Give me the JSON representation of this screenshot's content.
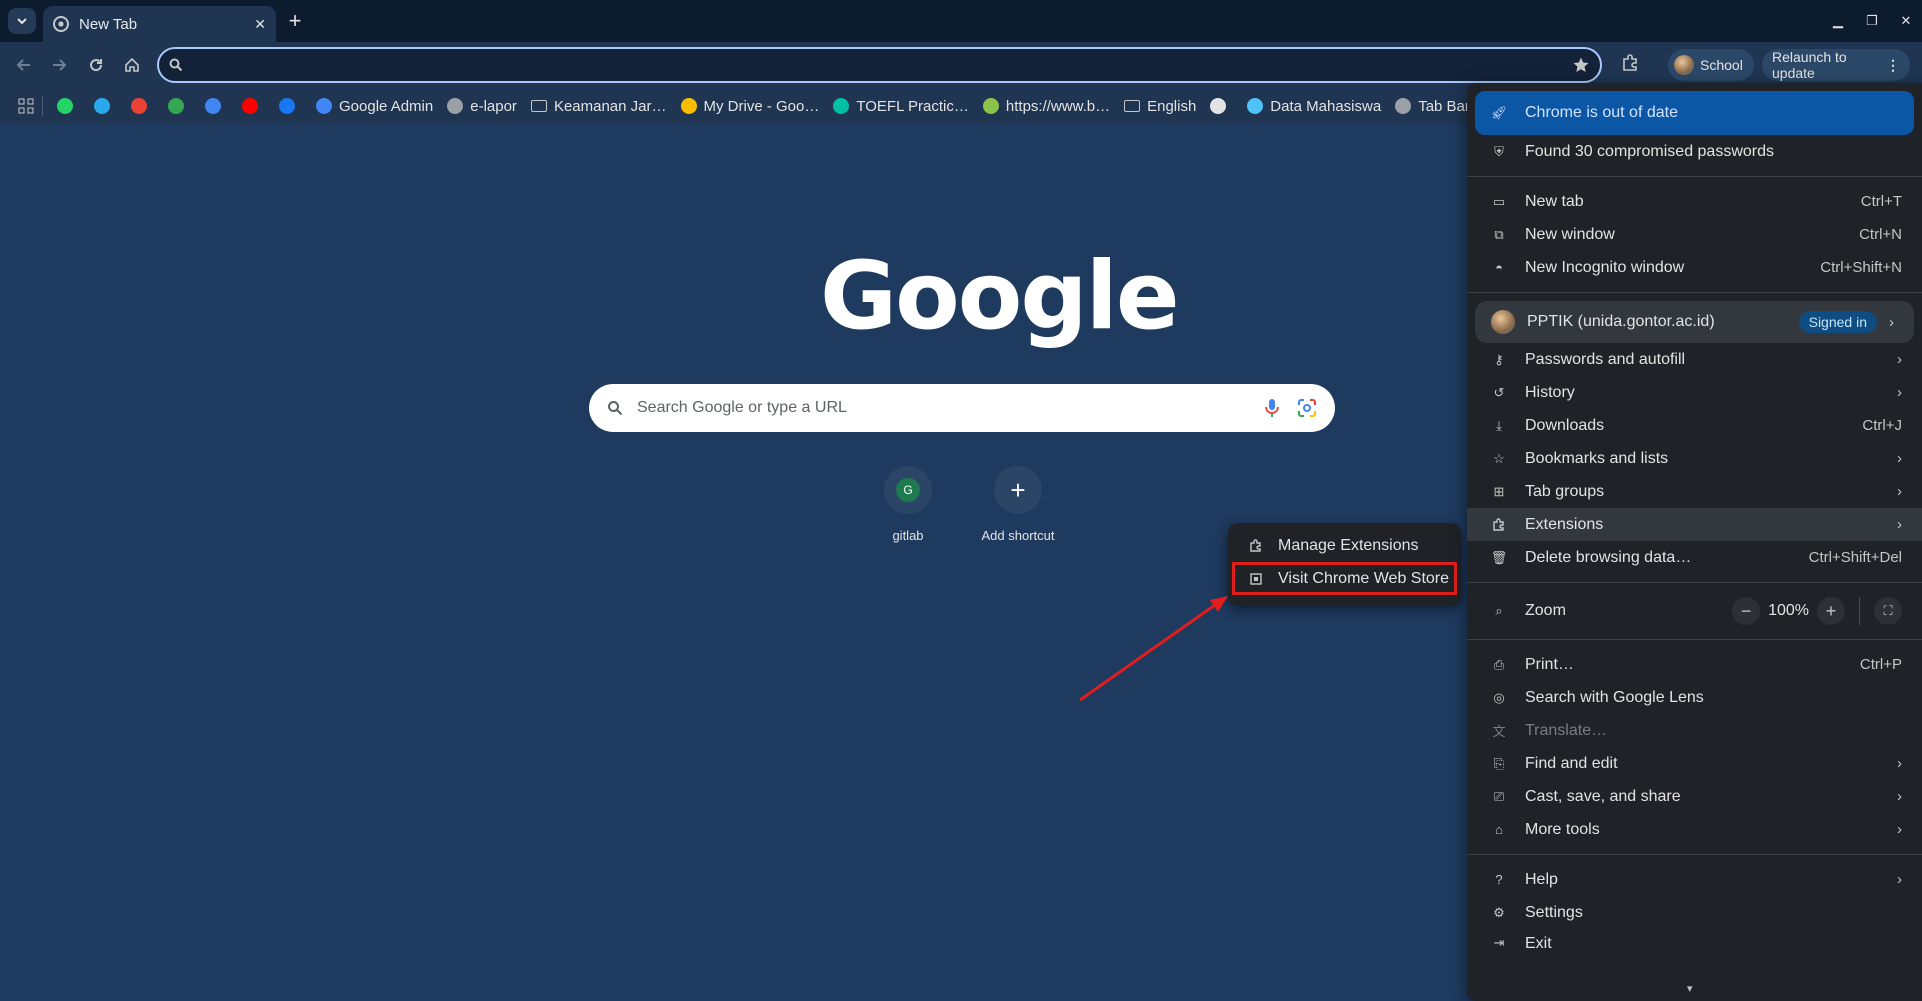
{
  "tab": {
    "title": "New Tab",
    "favicon": "chrome-icon"
  },
  "omnibox": {
    "value": "",
    "placeholder": ""
  },
  "profile_chip": {
    "label": "School"
  },
  "relaunch": {
    "label": "Relaunch to update"
  },
  "bookmarks": [
    {
      "label": "",
      "icon": "whatsapp-icon",
      "color": "#25d366"
    },
    {
      "label": "",
      "icon": "telegram-icon",
      "color": "#29a9eb"
    },
    {
      "label": "",
      "icon": "gmail-icon",
      "color": "#ea4335"
    },
    {
      "label": "",
      "icon": "maps-icon",
      "color": "#34a853"
    },
    {
      "label": "",
      "icon": "translate-icon",
      "color": "#4285f4"
    },
    {
      "label": "",
      "icon": "youtube-icon",
      "color": "#ff0000"
    },
    {
      "label": "",
      "icon": "facebook-icon",
      "color": "#1877f2"
    },
    {
      "label": "Google Admin",
      "icon": "admin-icon",
      "color": "#4285f4"
    },
    {
      "label": "e-lapor",
      "icon": "globe-icon",
      "color": "#9aa0a6"
    },
    {
      "label": "Keamanan Jar…",
      "icon": "folder-icon",
      "color": "#c4c7c5"
    },
    {
      "label": "My Drive - Goo…",
      "icon": "drive-icon",
      "color": "#fbbc04"
    },
    {
      "label": "TOEFL Practic…",
      "icon": "asterisk-icon",
      "color": "#00bfa5"
    },
    {
      "label": "https://www.b…",
      "icon": "site-icon",
      "color": "#8bc34a"
    },
    {
      "label": "English",
      "icon": "folder-icon",
      "color": "#c4c7c5"
    },
    {
      "label": "",
      "icon": "github-icon",
      "color": "#e3e3e3"
    },
    {
      "label": "Data Mahasiswa",
      "icon": "data-icon",
      "color": "#4fc3f7"
    },
    {
      "label": "Tab Bar",
      "icon": "globe-icon",
      "color": "#9aa0a6"
    }
  ],
  "ntp": {
    "logo": "Google",
    "search_placeholder": "Search Google or type a URL",
    "shortcuts": [
      {
        "label": "gitlab",
        "letter": "G",
        "color": "#1e7a4f"
      },
      {
        "label": "Add shortcut",
        "letter": "+"
      }
    ]
  },
  "menu": {
    "update": "Chrome is out of date",
    "passwords_alert": "Found 30 compromised passwords",
    "new_tab": {
      "label": "New tab",
      "shortcut": "Ctrl+T"
    },
    "new_window": {
      "label": "New window",
      "shortcut": "Ctrl+N"
    },
    "incognito": {
      "label": "New Incognito window",
      "shortcut": "Ctrl+Shift+N"
    },
    "profile": {
      "name": "PPTIK (unida.gontor.ac.id)",
      "status": "Signed in"
    },
    "passwords": "Passwords and autofill",
    "history": "History",
    "downloads": {
      "label": "Downloads",
      "shortcut": "Ctrl+J"
    },
    "bookmarks": "Bookmarks and lists",
    "tab_groups": "Tab groups",
    "extensions": "Extensions",
    "delete_data": {
      "label": "Delete browsing data…",
      "shortcut": "Ctrl+Shift+Del"
    },
    "zoom": {
      "label": "Zoom",
      "value": "100%"
    },
    "print": {
      "label": "Print…",
      "shortcut": "Ctrl+P"
    },
    "lens": "Search with Google Lens",
    "translate": "Translate…",
    "find_edit": "Find and edit",
    "cast": "Cast, save, and share",
    "more_tools": "More tools",
    "help": "Help",
    "settings": "Settings",
    "exit": "Exit"
  },
  "extensions_submenu": {
    "manage": "Manage Extensions",
    "store": "Visit Chrome Web Store"
  },
  "colors": {
    "annotation": "#e01e1e",
    "page_bg": "#1e3a5f",
    "menu_bg": "#1f2227"
  }
}
